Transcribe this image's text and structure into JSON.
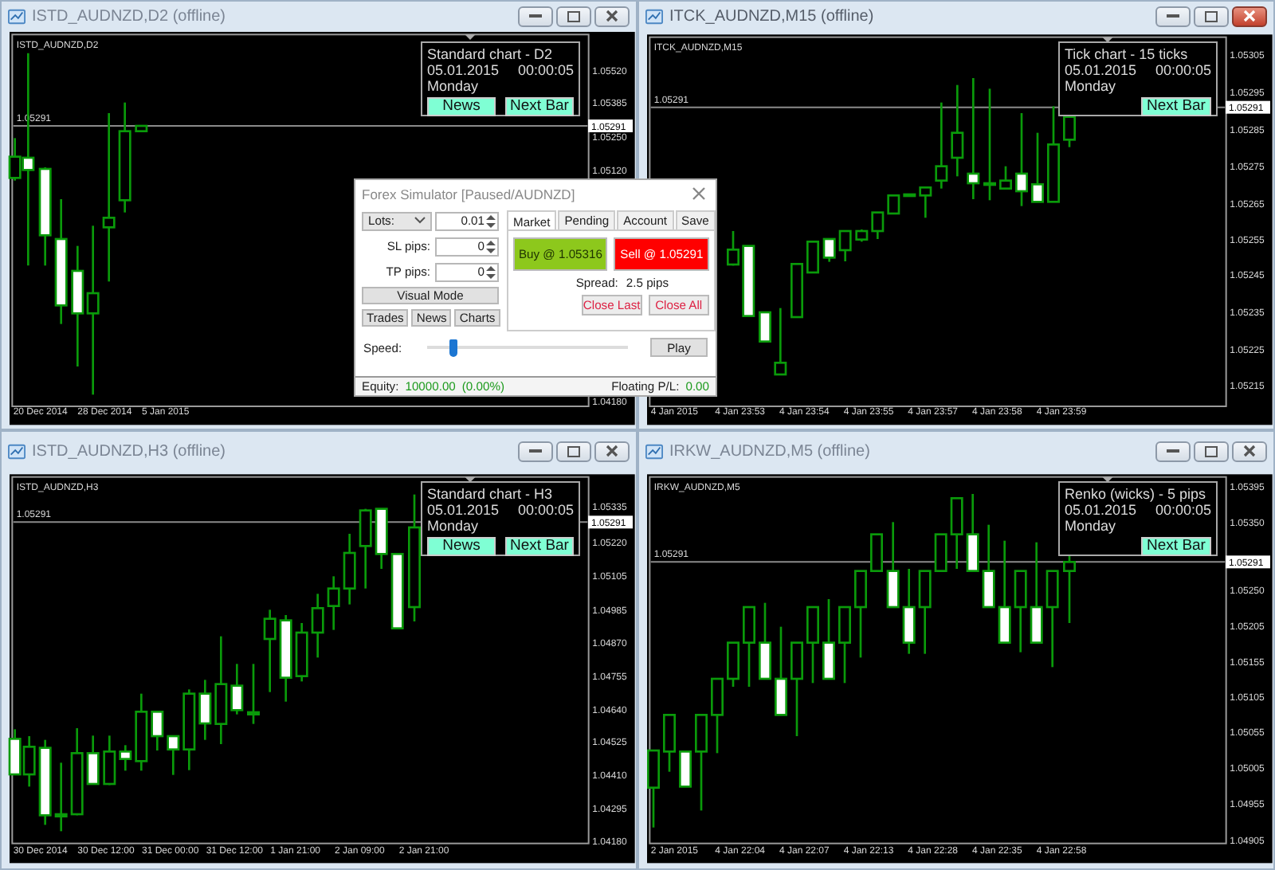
{
  "windows": [
    {
      "title": "ISTD_AUDNZD,D2 (offline)",
      "active": false,
      "chart_label": "ISTD_AUDNZD,D2",
      "price_line_label": "1.05291",
      "price_tag": "1.05291",
      "price_axis": [
        "1.05520",
        "1.05385",
        "1.05250",
        "1.05120",
        "1.04180"
      ],
      "time_axis": [
        "20 Dec 2014",
        "28 Dec 2014",
        "5 Jan 2015"
      ],
      "info": {
        "title": "Standard chart - D2",
        "date": "05.01.2015",
        "time": "00:00:05",
        "day": "Monday",
        "buttons": [
          "News",
          "Next Bar"
        ]
      }
    },
    {
      "title": "ITCK_AUDNZD,M15 (offline)",
      "active": true,
      "chart_label": "ITCK_AUDNZD,M15",
      "price_line_label": "1.05291",
      "price_tag": "1.05291",
      "price_axis": [
        "1.05305",
        "1.05295",
        "1.05285",
        "1.05275",
        "1.05265",
        "1.05255",
        "1.05245",
        "1.05235",
        "1.05225",
        "1.05215"
      ],
      "time_axis": [
        "4 Jan 2015",
        "4 Jan 23:53",
        "4 Jan 23:54",
        "4 Jan 23:55",
        "4 Jan 23:57",
        "4 Jan 23:58",
        "4 Jan 23:59"
      ],
      "info": {
        "title": "Tick chart - 15 ticks",
        "date": "05.01.2015",
        "time": "00:00:05",
        "day": "Monday",
        "buttons": [
          "Next Bar"
        ]
      }
    },
    {
      "title": "ISTD_AUDNZD,H3 (offline)",
      "active": false,
      "chart_label": "ISTD_AUDNZD,H3",
      "price_line_label": "1.05291",
      "price_tag": "1.05291",
      "price_axis": [
        "1.05335",
        "1.05220",
        "1.05105",
        "1.04985",
        "1.04870",
        "1.04755",
        "1.04640",
        "1.04525",
        "1.04410",
        "1.04295",
        "1.04180"
      ],
      "time_axis": [
        "30 Dec 2014",
        "30 Dec 12:00",
        "31 Dec 00:00",
        "31 Dec 12:00",
        "1 Jan 21:00",
        "2 Jan 09:00",
        "2 Jan 21:00"
      ],
      "info": {
        "title": "Standard chart - H3",
        "date": "05.01.2015",
        "time": "00:00:05",
        "day": "Monday",
        "buttons": [
          "News",
          "Next Bar"
        ]
      }
    },
    {
      "title": "IRKW_AUDNZD,M5 (offline)",
      "active": false,
      "chart_label": "IRKW_AUDNZD,M5",
      "price_line_label": "1.05291",
      "price_tag": "1.05291",
      "price_axis": [
        "1.05395",
        "1.05350",
        "1.05250",
        "1.05205",
        "1.05155",
        "1.05105",
        "1.05055",
        "1.05005",
        "1.04955",
        "1.04905"
      ],
      "time_axis": [
        "2 Jan 2015",
        "4 Jan 22:04",
        "4 Jan 22:07",
        "4 Jan 22:13",
        "4 Jan 22:28",
        "4 Jan 22:35",
        "4 Jan 22:58"
      ],
      "info": {
        "title": "Renko (wicks) - 5 pips",
        "date": "05.01.2015",
        "time": "00:00:05",
        "day": "Monday",
        "buttons": [
          "Next Bar"
        ]
      }
    }
  ],
  "simulator": {
    "title": "Forex Simulator  [Paused/AUDNZD]",
    "lots_label": "Lots:",
    "lots": "0.01",
    "sl_label": "SL pips:",
    "sl": "0",
    "tp_label": "TP pips:",
    "tp": "0",
    "visual_mode": "Visual Mode",
    "panel_buttons": [
      "Trades",
      "News",
      "Charts"
    ],
    "tabs": [
      {
        "label": "Market",
        "selected": true
      },
      {
        "label": "Pending",
        "selected": false
      },
      {
        "label": "Account",
        "selected": false
      },
      {
        "label": "Save",
        "selected": false
      }
    ],
    "trade_buttons": [
      {
        "label": "Buy @ 1.05316",
        "kind": "buy"
      },
      {
        "label": "Sell @ 1.05291",
        "kind": "sell"
      }
    ],
    "spread_label": "Spread:",
    "spread": "2.5 pips",
    "close_buttons": [
      "Close Last",
      "Close All"
    ],
    "speed_label": "Speed:",
    "speed": {
      "level": 0.13
    },
    "play": "Play",
    "equity_label": "Equity:",
    "equity": "10000.00",
    "equity_pct": "(0.00%)",
    "pl_label": "Floating P/L:",
    "pl": "0.00"
  }
}
